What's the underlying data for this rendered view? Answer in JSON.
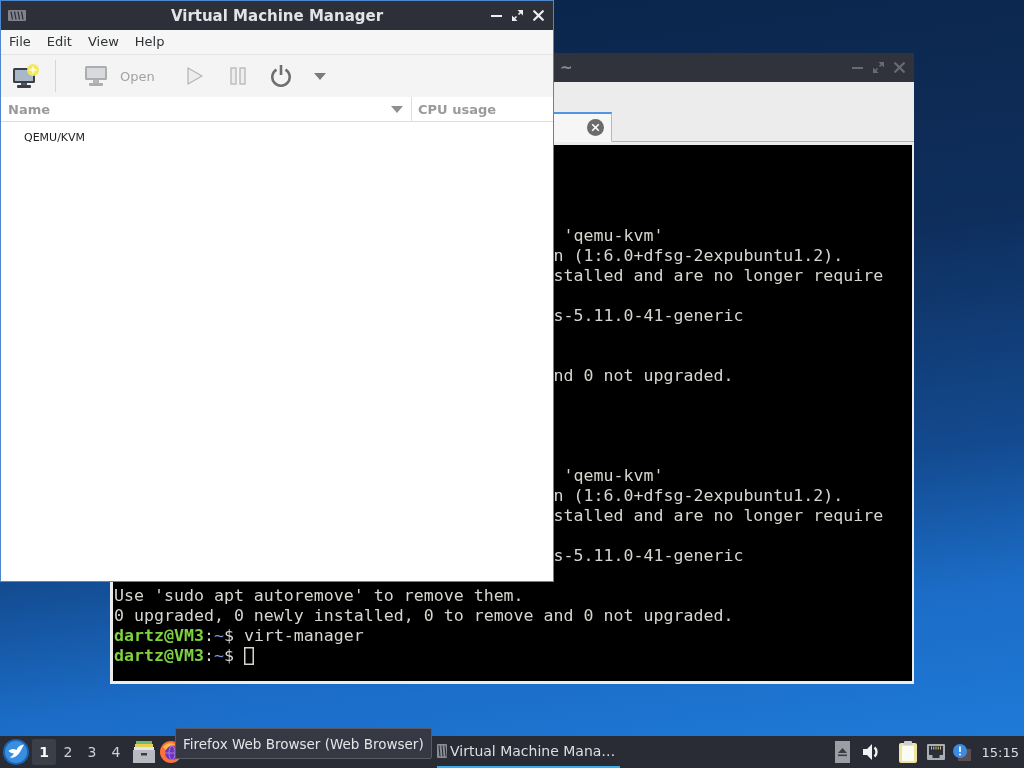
{
  "vmm_window": {
    "title": "Virtual Machine Manager",
    "active": true,
    "menu": [
      "File",
      "Edit",
      "View",
      "Help"
    ],
    "toolbar": [
      {
        "kind": "new",
        "disabled": false
      },
      {
        "kind": "separator"
      },
      {
        "kind": "open",
        "label": "Open",
        "disabled": true
      },
      {
        "kind": "run",
        "disabled": true
      },
      {
        "kind": "pause",
        "disabled": true
      },
      {
        "kind": "shutdown",
        "disabled": false
      },
      {
        "kind": "menu",
        "disabled": false
      }
    ],
    "columns": [
      {
        "label": "Name",
        "sorted": true
      },
      {
        "label": "CPU usage",
        "sorted": false
      }
    ],
    "rows": [
      {
        "name": "QEMU/KVM"
      }
    ]
  },
  "terminal_window": {
    "title": "~",
    "active": false,
    "tabs": [
      {
        "selected": true
      }
    ],
    "lines": [
      {
        "kind": "blank"
      },
      {
        "kind": "blank"
      },
      {
        "kind": "blank"
      },
      {
        "kind": "blank"
      },
      {
        "kind": "partial",
        "text": " 'qemu-kvm'"
      },
      {
        "kind": "partial",
        "text": "n (1:6.0+dfsg-2expubuntu1.2)."
      },
      {
        "kind": "partial",
        "text": "stalled and are no longer require"
      },
      {
        "kind": "blank"
      },
      {
        "kind": "partial",
        "text": "s-5.11.0-41-generic"
      },
      {
        "kind": "blank"
      },
      {
        "kind": "blank"
      },
      {
        "kind": "partial",
        "text": "nd 0 not upgraded."
      },
      {
        "kind": "blank"
      },
      {
        "kind": "blank"
      },
      {
        "kind": "blank"
      },
      {
        "kind": "blank"
      },
      {
        "kind": "partial",
        "text": " 'qemu-kvm'"
      },
      {
        "kind": "partial",
        "text": "n (1:6.0+dfsg-2expubuntu1.2)."
      },
      {
        "kind": "partial",
        "text": "stalled and are no longer require"
      },
      {
        "kind": "blank"
      },
      {
        "kind": "partial",
        "text": "s-5.11.0-41-generic"
      },
      {
        "kind": "blank"
      },
      {
        "kind": "output",
        "text": "Use 'sudo apt autoremove' to remove them."
      },
      {
        "kind": "output",
        "text": "0 upgraded, 0 newly installed, 0 to remove and 0 not upgraded."
      },
      {
        "kind": "prompt",
        "user_host": "dartz@VM3",
        "separator": ":",
        "path": "~",
        "symbol": "$",
        "command": "virt-manager",
        "cursor": false
      },
      {
        "kind": "prompt",
        "user_host": "dartz@VM3",
        "separator": ":",
        "path": "~",
        "symbol": "$",
        "cursor": true
      }
    ]
  },
  "taskbar": {
    "workspaces": [
      {
        "label": "1",
        "selected": true
      },
      {
        "label": "2",
        "selected": false
      },
      {
        "label": "3",
        "selected": false
      },
      {
        "label": "4",
        "selected": false
      }
    ],
    "tooltip": "Firefox Web Browser (Web Browser)",
    "tasks": [
      {
        "label": "Virtual Machine Mana…",
        "active": true
      }
    ],
    "clock": "15:15"
  }
}
